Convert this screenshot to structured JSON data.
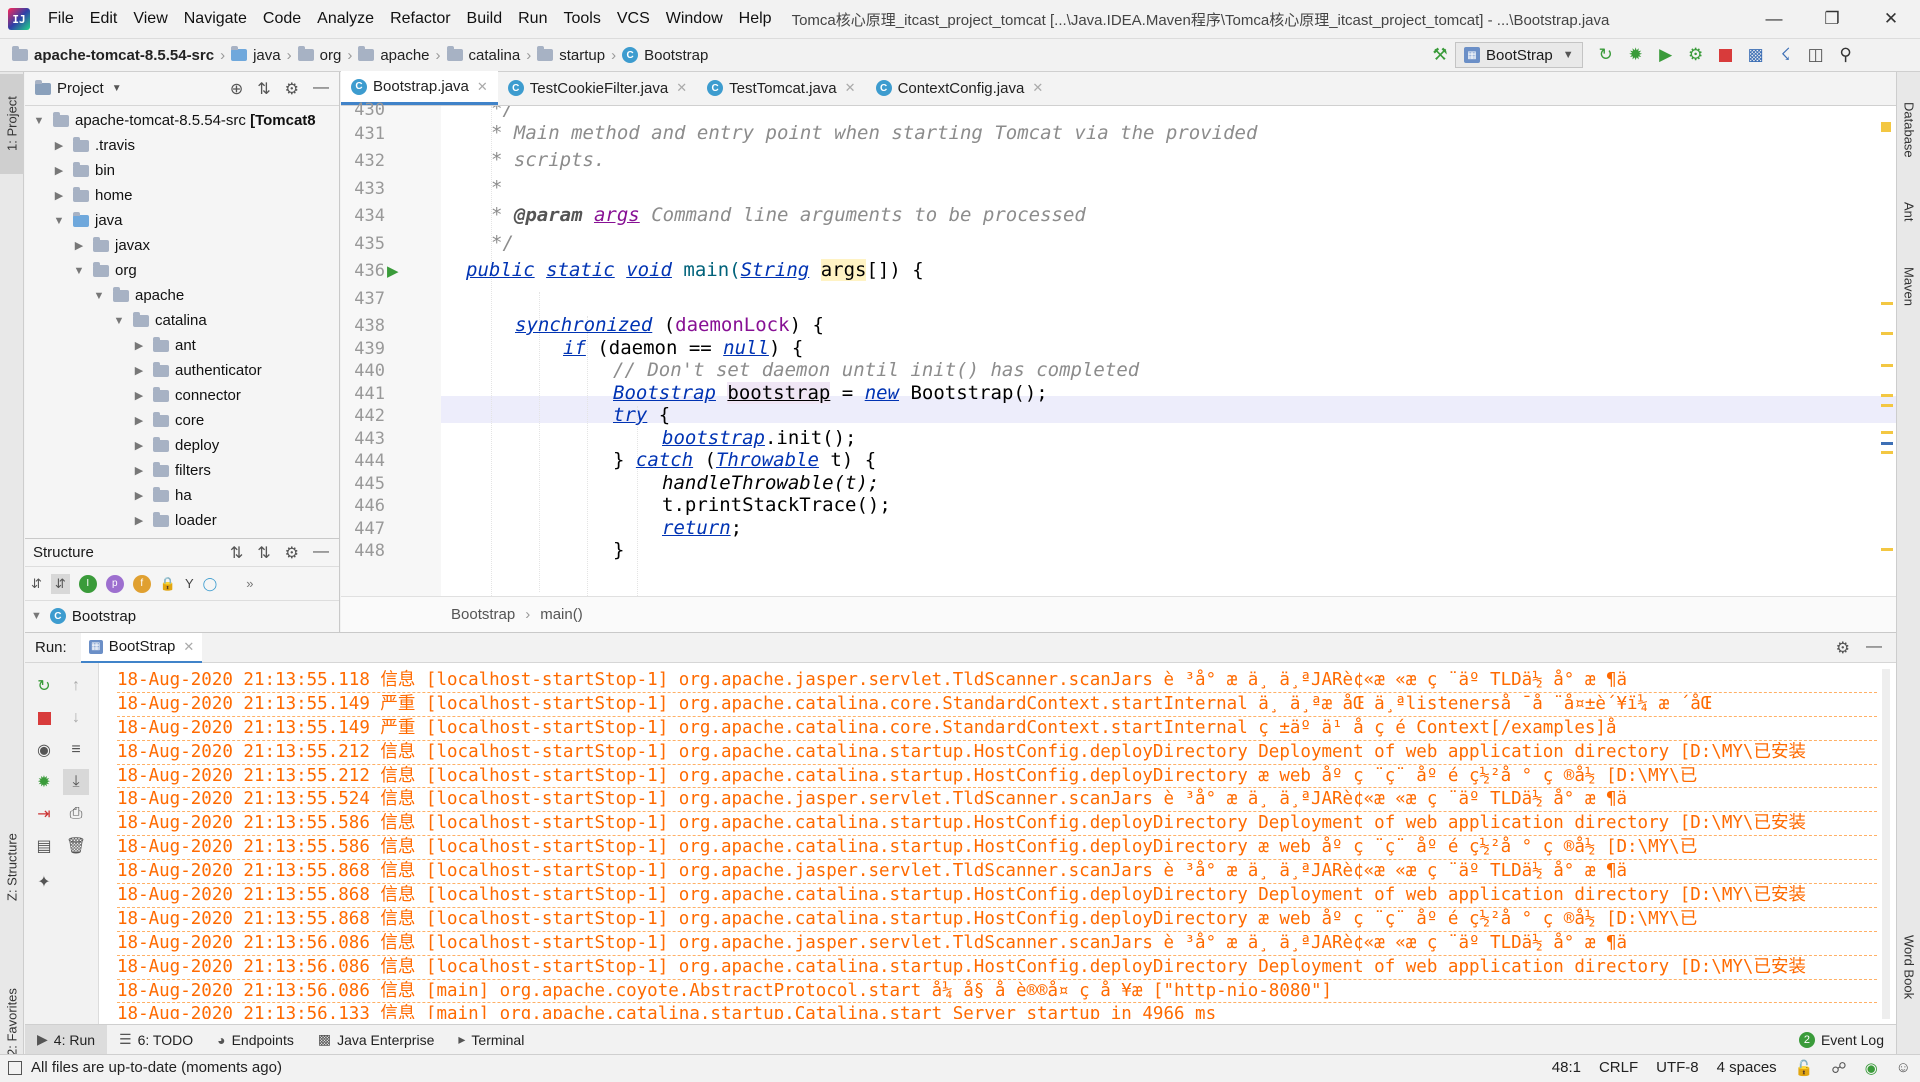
{
  "app": {
    "menu": [
      "File",
      "Edit",
      "View",
      "Navigate",
      "Code",
      "Analyze",
      "Refactor",
      "Build",
      "Run",
      "Tools",
      "VCS",
      "Window",
      "Help"
    ],
    "window_title": "Tomca核心原理_itcast_project_tomcat [...\\Java.IDEA.Maven程序\\Tomca核心原理_itcast_project_tomcat] - ...\\Bootstrap.java",
    "logo_text": "IJ"
  },
  "breadcrumbs": [
    "apache-tomcat-8.5.54-src",
    "java",
    "org",
    "apache",
    "catalina",
    "startup",
    "Bootstrap"
  ],
  "run_config": "BootStrap",
  "left_tabs": {
    "project": "1: Project",
    "structure": "Z: Structure",
    "favorites": "2: Favorites"
  },
  "right_tabs": {
    "database": "Database",
    "ant": "Ant",
    "maven": "Maven",
    "wordbook": "Word Book"
  },
  "project_panel": {
    "title": "Project",
    "tree": [
      {
        "label": "apache-tomcat-8.5.54-src [Tomcat8",
        "depth": 0,
        "expanded": true,
        "bold_suffix": true
      },
      {
        "label": ".travis",
        "depth": 1,
        "expanded": false
      },
      {
        "label": "bin",
        "depth": 1,
        "expanded": false
      },
      {
        "label": "home",
        "depth": 1,
        "expanded": false
      },
      {
        "label": "java",
        "depth": 1,
        "expanded": true,
        "src": true
      },
      {
        "label": "javax",
        "depth": 2,
        "expanded": false
      },
      {
        "label": "org",
        "depth": 2,
        "expanded": true
      },
      {
        "label": "apache",
        "depth": 3,
        "expanded": true
      },
      {
        "label": "catalina",
        "depth": 4,
        "expanded": true
      },
      {
        "label": "ant",
        "depth": 5,
        "expanded": false
      },
      {
        "label": "authenticator",
        "depth": 5,
        "expanded": false
      },
      {
        "label": "connector",
        "depth": 5,
        "expanded": false
      },
      {
        "label": "core",
        "depth": 5,
        "expanded": false
      },
      {
        "label": "deploy",
        "depth": 5,
        "expanded": false
      },
      {
        "label": "filters",
        "depth": 5,
        "expanded": false
      },
      {
        "label": "ha",
        "depth": 5,
        "expanded": false
      },
      {
        "label": "loader",
        "depth": 5,
        "expanded": false
      }
    ]
  },
  "structure_panel": {
    "title": "Structure",
    "root": "Bootstrap"
  },
  "editor": {
    "tabs": [
      {
        "label": "Bootstrap.java",
        "active": true
      },
      {
        "label": "TestCookieFilter.java",
        "active": false
      },
      {
        "label": "TestTomcat.java",
        "active": false
      },
      {
        "label": "ContextConfig.java",
        "active": false
      }
    ],
    "line_numbers": [
      "430",
      "431",
      "432",
      "433",
      "434",
      "435",
      "436",
      "437",
      "438",
      "439",
      "440",
      "441",
      "442",
      "443",
      "444",
      "445",
      "446",
      "447",
      "448"
    ],
    "breadcrumb": [
      "Bootstrap",
      "main()"
    ],
    "code": {
      "l430": "*/",
      "l431": "* Main method and entry point when starting Tomcat via the provided",
      "l432": "* scripts.",
      "l433": "*",
      "l434a": "* ",
      "l434b": "@param",
      "l434c": "args",
      "l434d": " Command line arguments to be processed",
      "l435": "*/",
      "l436": [
        "public",
        " ",
        "static",
        " ",
        "void",
        " ",
        "main(",
        "String",
        " ",
        "args",
        "[]) {"
      ],
      "l438": [
        "synchronized",
        " (",
        "daemonLock",
        ") {"
      ],
      "l439": [
        "if",
        " (daemon == ",
        "null",
        ") {"
      ],
      "l440": "// Don't set daemon until init() has completed",
      "l441": [
        "Bootstrap",
        " ",
        "bootstrap",
        " = ",
        "new",
        " Bootstrap();"
      ],
      "l442": [
        "try",
        " {"
      ],
      "l443": [
        "bootstrap",
        ".init();"
      ],
      "l444": [
        "} ",
        "catch",
        " (",
        "Throwable",
        " t) {"
      ],
      "l445": "handleThrowable(t);",
      "l446": "t.printStackTrace();",
      "l447": [
        "return",
        ";"
      ],
      "l448": "}"
    }
  },
  "run_panel": {
    "label": "Run:",
    "tab": "BootStrap",
    "log": [
      "18-Aug-2020 21:13:55.118 信息 [localhost-startStop-1] org.apache.jasper.servlet.TldScanner.scanJars è ³å° æ   ä¸ ä¸ªJARè¢«æ «æ     ç ¨äº TLDä½ å° æ ¶ä",
      "18-Aug-2020 21:13:55.149 严重 [localhost-startStop-1] org.apache.catalina.core.StandardContext.startInternal ä¸ ä¸ªæ  åŒ ä¸ªlistenerså ¯å ¨å¤±è´¥ï¼ æ ´åŒ",
      "18-Aug-2020 21:13:55.149 严重 [localhost-startStop-1] org.apache.catalina.core.StandardContext.startInternal ç ±äº ä¹ å  ç  é  Context[/examples]å",
      "18-Aug-2020 21:13:55.212 信息 [localhost-startStop-1] org.apache.catalina.startup.HostConfig.deployDirectory Deployment of web application directory [D:\\MY\\已安装",
      "18-Aug-2020 21:13:55.212 信息 [localhost-startStop-1] org.apache.catalina.startup.HostConfig.deployDirectory æ   web åº ç ¨ç¨ åº é  ç½²å ° ç ®å½ [D:\\MY\\已",
      "18-Aug-2020 21:13:55.524 信息 [localhost-startStop-1] org.apache.jasper.servlet.TldScanner.scanJars è ³å° æ   ä¸ ä¸ªJARè¢«æ «æ     ç ¨äº TLDä½ å° æ ¶ä",
      "18-Aug-2020 21:13:55.586 信息 [localhost-startStop-1] org.apache.catalina.startup.HostConfig.deployDirectory Deployment of web application directory [D:\\MY\\已安装",
      "18-Aug-2020 21:13:55.586 信息 [localhost-startStop-1] org.apache.catalina.startup.HostConfig.deployDirectory æ   web åº ç ¨ç¨ åº é  ç½²å ° ç ®å½ [D:\\MY\\已",
      "18-Aug-2020 21:13:55.868 信息 [localhost-startStop-1] org.apache.jasper.servlet.TldScanner.scanJars è ³å° æ   ä¸ ä¸ªJARè¢«æ «æ     ç ¨äº TLDä½ å° æ ¶ä",
      "18-Aug-2020 21:13:55.868 信息 [localhost-startStop-1] org.apache.catalina.startup.HostConfig.deployDirectory Deployment of web application directory [D:\\MY\\已安装",
      "18-Aug-2020 21:13:55.868 信息 [localhost-startStop-1] org.apache.catalina.startup.HostConfig.deployDirectory æ   web åº ç ¨ç¨ åº é  ç½²å ° ç ®å½ [D:\\MY\\已",
      "18-Aug-2020 21:13:56.086 信息 [localhost-startStop-1] org.apache.jasper.servlet.TldScanner.scanJars è ³å° æ   ä¸ ä¸ªJARè¢«æ «æ     ç ¨äº TLDä½ å° æ ¶ä",
      "18-Aug-2020 21:13:56.086 信息 [localhost-startStop-1] org.apache.catalina.startup.HostConfig.deployDirectory Deployment of web application directory [D:\\MY\\已安装",
      "18-Aug-2020 21:13:56.086 信息 [main] org.apache.coyote.AbstractProtocol.start å¼ å§ å  è®®å¤ ç  å ¥æ  [\"http-nio-8080\"]",
      "18-Aug-2020 21:13:56.133 信息 [main] org.apache.catalina.startup.Catalina.start Server startup in 4966 ms"
    ]
  },
  "bottom_tabs": [
    {
      "label": "4: Run",
      "active": true
    },
    {
      "label": "6: TODO",
      "active": false
    },
    {
      "label": "Endpoints",
      "active": false
    },
    {
      "label": "Java Enterprise",
      "active": false
    },
    {
      "label": "Terminal",
      "active": false
    }
  ],
  "event_log": {
    "label": "Event Log",
    "count": "2"
  },
  "status": {
    "message": "All files are up-to-date (moments ago)",
    "position": "48:1",
    "line_sep": "CRLF",
    "encoding": "UTF-8",
    "indent": "4 spaces"
  },
  "colors": {
    "accent": "#4083c9",
    "log_text": "#ff6a00",
    "keyword": "#0033b3",
    "comment": "#8c8c8c",
    "stop_red": "#d83b3b",
    "run_green": "#3a9b3a"
  }
}
